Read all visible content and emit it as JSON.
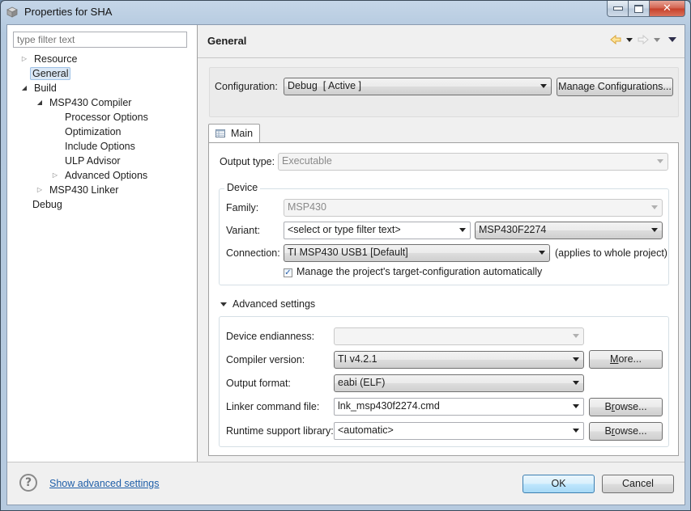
{
  "window": {
    "title": "Properties for SHA",
    "controls": {
      "minimize": "minimize",
      "maximize": "maximize",
      "close": "close"
    }
  },
  "sidebar": {
    "filter_placeholder": "type filter text",
    "items": [
      {
        "label": "Resource",
        "level": 0,
        "expander": "collapsed"
      },
      {
        "label": "General",
        "level": 0,
        "expander": "none",
        "selected": true
      },
      {
        "label": "Build",
        "level": 0,
        "expander": "expanded"
      },
      {
        "label": "MSP430 Compiler",
        "level": 1,
        "expander": "expanded"
      },
      {
        "label": "Processor Options",
        "level": 2,
        "expander": "none"
      },
      {
        "label": "Optimization",
        "level": 2,
        "expander": "none"
      },
      {
        "label": "Include Options",
        "level": 2,
        "expander": "none"
      },
      {
        "label": "ULP Advisor",
        "level": 2,
        "expander": "none"
      },
      {
        "label": "Advanced Options",
        "level": 2,
        "expander": "collapsed"
      },
      {
        "label": "MSP430 Linker",
        "level": 1,
        "expander": "collapsed"
      },
      {
        "label": "Debug",
        "level": 0,
        "expander": "none"
      }
    ]
  },
  "header": {
    "title": "General",
    "nav_icons": [
      "back-arrow-icon",
      "back-menu-icon",
      "forward-arrow-icon",
      "forward-menu-icon",
      "view-menu-icon"
    ]
  },
  "configuration": {
    "label": "Configuration:",
    "value": "Debug  [ Active ]",
    "manage_button": "Manage Configurations..."
  },
  "tabs": [
    {
      "label": "Main",
      "icon": "table-icon",
      "active": true
    }
  ],
  "main": {
    "output_type": {
      "label": "Output type:",
      "value": "Executable"
    },
    "device": {
      "title": "Device",
      "family": {
        "label": "Family:",
        "value": "MSP430"
      },
      "variant": {
        "label": "Variant:",
        "filter_value": "<select or type filter text>",
        "value": "MSP430F2274"
      },
      "connection": {
        "label": "Connection:",
        "value": "TI MSP430 USB1 [Default]",
        "note": "(applies to whole project)"
      },
      "manage_target": {
        "label": "Manage the project's target-configuration automatically",
        "checked": true
      }
    },
    "advanced": {
      "toggle_label": "Advanced settings",
      "expanded": true,
      "endianness": {
        "label": "Device endianness:",
        "value": ""
      },
      "compiler_version": {
        "label": "Compiler version:",
        "value": "TI v4.2.1",
        "button": "More...",
        "mnemonic": "M"
      },
      "output_format": {
        "label": "Output format:",
        "value": "eabi (ELF)"
      },
      "linker_cmd": {
        "label": "Linker command file:",
        "value": "lnk_msp430f2274.cmd",
        "button": "Browse...",
        "mnemonic": "r"
      },
      "runtime_lib": {
        "label": "Runtime support library:",
        "value": "<automatic>",
        "button": "Browse...",
        "mnemonic": "r"
      }
    }
  },
  "footer": {
    "help_icon": "help-icon",
    "link": "Show advanced settings",
    "ok": "OK",
    "cancel": "Cancel"
  }
}
